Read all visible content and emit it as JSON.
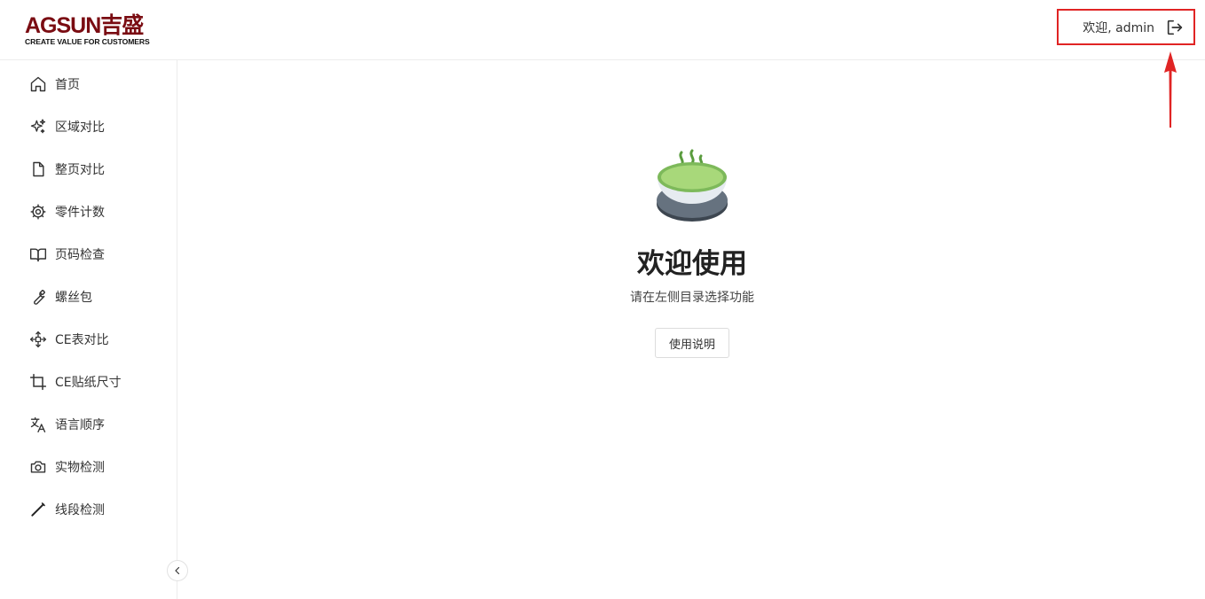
{
  "header": {
    "logo_main": "AGSUN吉盛",
    "logo_tagline": "CREATE VALUE FOR CUSTOMERS",
    "user_greeting": "欢迎, admin",
    "logout_icon": "logout-icon"
  },
  "sidebar": {
    "items": [
      {
        "label": "首页",
        "icon": "home-icon"
      },
      {
        "label": "区域对比",
        "icon": "sparkles-icon"
      },
      {
        "label": "整页对比",
        "icon": "file-icon"
      },
      {
        "label": "零件计数",
        "icon": "cog-icon"
      },
      {
        "label": "页码检查",
        "icon": "book-open-icon"
      },
      {
        "label": "螺丝包",
        "icon": "wrench-icon"
      },
      {
        "label": "CE表对比",
        "icon": "move-icon"
      },
      {
        "label": "CE贴纸尺寸",
        "icon": "crop-icon"
      },
      {
        "label": "语言顺序",
        "icon": "languages-icon"
      },
      {
        "label": "实物检测",
        "icon": "camera-icon"
      },
      {
        "label": "线段检测",
        "icon": "pen-line-icon"
      }
    ],
    "collapse_icon": "chevron-left-icon"
  },
  "main": {
    "title": "欢迎使用",
    "subtitle": "请在左侧目录选择功能",
    "help_button": "使用说明"
  },
  "colors": {
    "logo": "#7a0c12",
    "highlight_box": "#e02424",
    "tea_green": "#7db95a",
    "bowl_gray": "#5f6b78"
  }
}
